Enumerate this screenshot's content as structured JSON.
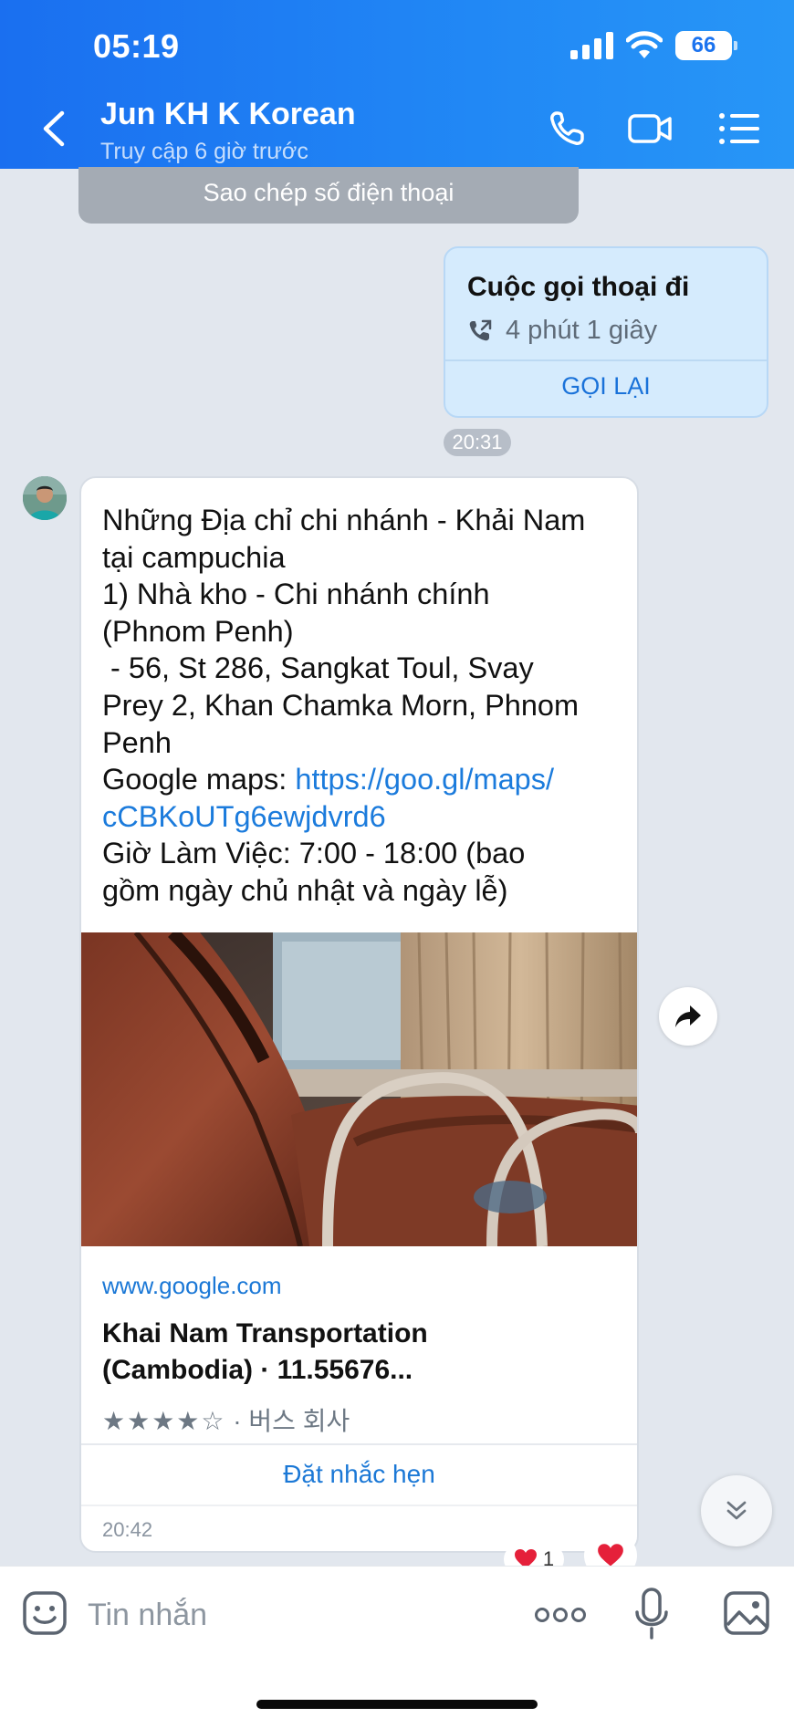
{
  "status_bar": {
    "time": "05:19",
    "battery": "66"
  },
  "header": {
    "contact_name": "Jun KH K Korean",
    "last_seen": "Truy cập 6 giờ trước"
  },
  "chat": {
    "copy_phone_label": "Sao chép số điện thoại",
    "call_card": {
      "title": "Cuộc gọi thoại đi",
      "duration": "4 phút 1 giây",
      "call_back_label": "GỌI LẠI"
    },
    "call_time": "20:31",
    "message": {
      "lines": [
        "Những Địa chỉ chi nhánh - Khải Nam",
        "tại campuchia",
        "1) Nhà kho - Chi nhánh chính",
        "(Phnom Penh)",
        " - 56, St 286, Sangkat Toul, Svay",
        "Prey 2, Khan Chamka Morn, Phnom",
        "Penh"
      ],
      "maps_prefix": "Google maps: ",
      "link_line1": "https://goo.gl/maps/",
      "link_line2": "cCBKoUTg6ewjdvrd6",
      "hours_line1": "Giờ Làm Việc: 7:00 - 18:00 (bao",
      "hours_line2": "gồm ngày chủ nhật và ngày lễ)",
      "preview": {
        "domain": "www.google.com",
        "title_line1": "Khai Nam Transportation",
        "title_line2": "(Cambodia) · 11.55676...",
        "stars": "★★★★☆",
        "rating_value": 4,
        "category": " · 버스 회사"
      },
      "remind_label": "Đặt nhắc hẹn",
      "time": "20:42",
      "reaction_count": "1"
    }
  },
  "composer": {
    "placeholder": "Tin nhắn"
  },
  "colors": {
    "header_blue": "#1a6ff0",
    "link_blue": "#1b78d6",
    "call_card_bg": "#d5ebfd",
    "heart_red": "#e5203a"
  },
  "icons": [
    "back-icon",
    "phone-icon",
    "video-icon",
    "menu-icon",
    "phone-outgoing-icon",
    "forward-icon",
    "chevron-double-down-icon",
    "heart-icon",
    "emoji-icon",
    "more-icon",
    "mic-icon",
    "gallery-icon"
  ]
}
